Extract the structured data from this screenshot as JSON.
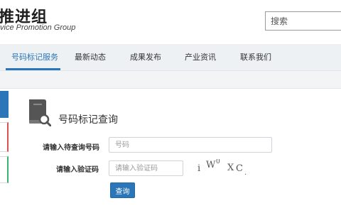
{
  "header": {
    "logo_cn": "推进组",
    "logo_en": "vice  Promotion Group",
    "search_placeholder": "搜索"
  },
  "nav": {
    "items": [
      {
        "label": "号码标记服务",
        "active": true
      },
      {
        "label": "最新动态",
        "active": false
      },
      {
        "label": "成果发布",
        "active": false
      },
      {
        "label": "产业资讯",
        "active": false
      },
      {
        "label": "联系我们",
        "active": false
      }
    ]
  },
  "main": {
    "section_title": "号码标记查询",
    "form": {
      "number_label": "请输入待查询号码",
      "number_placeholder": "号码",
      "captcha_label": "请输入验证码",
      "captcha_placeholder": "请输入验证码",
      "captcha_text": "i W 0 X C .",
      "submit_label": "查询"
    }
  },
  "colors": {
    "accent": "#2a76b8",
    "nav_bg": "#eef1f4",
    "side_red": "#d9534f",
    "side_green": "#3cb371"
  }
}
